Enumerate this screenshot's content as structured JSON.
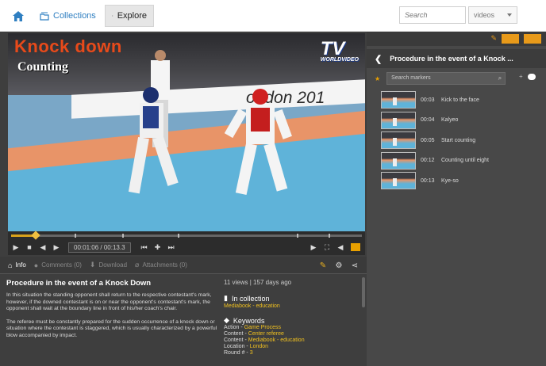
{
  "topbar": {
    "collections_label": "Collections",
    "explore_label": "Explore",
    "search_placeholder": "Search",
    "search_type": "videos"
  },
  "video": {
    "overlay_title": "Knock down",
    "overlay_subtitle": "Counting",
    "broadcaster_logo": "TV",
    "broadcaster_sub": "WORLDVIDEO",
    "hoarding_text": "ondon 201",
    "current_time": "00:01:06",
    "total_time": "00:13.3",
    "progress_fraction": 0.07
  },
  "info_tabs": [
    {
      "label": "Info",
      "active": true,
      "icon": "home-icon"
    },
    {
      "label": "Comments (0)",
      "active": false,
      "icon": "comment-icon"
    },
    {
      "label": "Download",
      "active": false,
      "icon": "download-icon"
    },
    {
      "label": "Attachments (0)",
      "active": false,
      "icon": "attachment-icon"
    }
  ],
  "description": {
    "title": "Procedure in the event of a Knock Down",
    "paragraph1": "In this situation the standing opponent shall return to the respective contestant's mark, however, if the downed contestant is on or near the opponent's contestant's mark, the opponent shall wait at the boundary line in front of his/her coach's chair.",
    "paragraph2": "The referee must be constantly prepared for the sudden occurrence of a knock down or situation where the contestant is staggered, which is usually characterized by a powerful blow accompanied by impact."
  },
  "meta": {
    "views": "11 views | 157 days ago",
    "in_collection_label": "In collection",
    "collection_name": "Mediabook - education",
    "keywords_label": "Keywords",
    "keywords": [
      {
        "key": "Action",
        "value": "Game Process"
      },
      {
        "key": "Content",
        "value": "Center referee"
      },
      {
        "key": "Content",
        "value": "Mediabook - education"
      },
      {
        "key": "Location",
        "value": "London"
      },
      {
        "key": "Round #",
        "value": "3"
      }
    ]
  },
  "right_panel": {
    "title": "Procedure in the event of a Knock ...",
    "search_placeholder": "Search markers",
    "markers": [
      {
        "time": "00:03",
        "label": "Kick to the face"
      },
      {
        "time": "00:04",
        "label": "Kalyeo"
      },
      {
        "time": "00:05",
        "label": "Start counting"
      },
      {
        "time": "00:12",
        "label": "Counting until eight"
      },
      {
        "time": "00:13",
        "label": "Kye-so"
      }
    ]
  },
  "colors": {
    "accent": "#e8a000",
    "link": "#2f7fc1",
    "panel_bg": "#3e3e3e",
    "keyword_value": "#f0c020"
  }
}
